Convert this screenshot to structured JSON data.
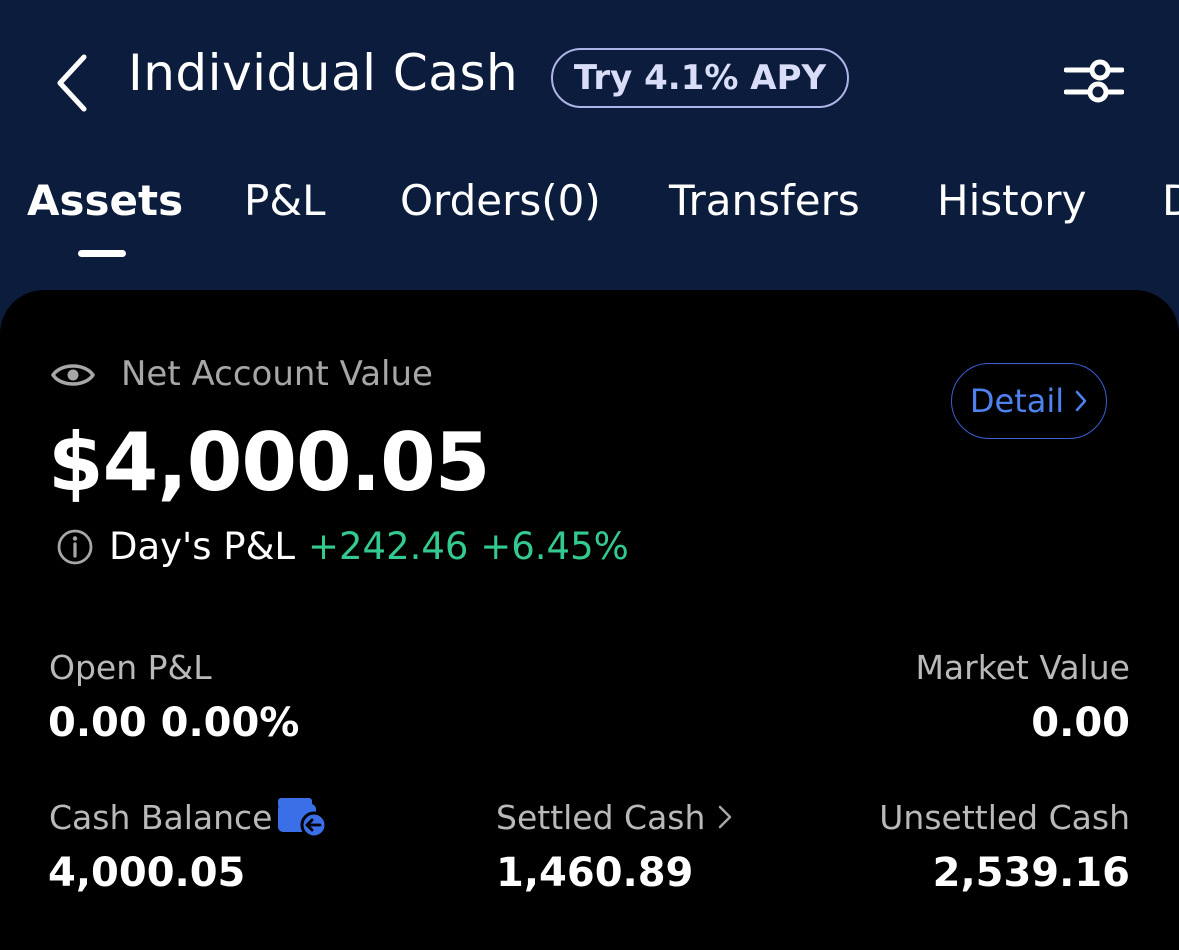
{
  "header": {
    "title": "Individual Cash",
    "apy_badge": "Try 4.1% APY",
    "back_icon": "chevron-left-icon",
    "filter_icon": "sliders-icon"
  },
  "tabs": [
    {
      "label": "Assets",
      "active": true
    },
    {
      "label": "P&L",
      "active": false
    },
    {
      "label": "Orders(0)",
      "active": false
    },
    {
      "label": "Transfers",
      "active": false
    },
    {
      "label": "History",
      "active": false
    },
    {
      "label": "D",
      "active": false
    }
  ],
  "account": {
    "net_label": "Net Account Value",
    "net_value": "$4,000.05",
    "detail_label": "Detail",
    "days_pl_label": "Day's P&L",
    "days_pl_value": "+242.46 +6.45%"
  },
  "stats": {
    "open_pl_label": "Open P&L",
    "open_pl_value": "0.00 0.00%",
    "market_value_label": "Market Value",
    "market_value_value": "0.00",
    "cash_balance_label": "Cash Balance",
    "cash_balance_value": "4,000.05",
    "settled_cash_label": "Settled Cash",
    "settled_cash_value": "1,460.89",
    "unsettled_cash_label": "Unsettled Cash",
    "unsettled_cash_value": "2,539.16"
  },
  "colors": {
    "header_bg": "#0c1c3d",
    "card_bg": "#000000",
    "positive": "#34c98e",
    "accent_blue": "#4d82ef"
  }
}
